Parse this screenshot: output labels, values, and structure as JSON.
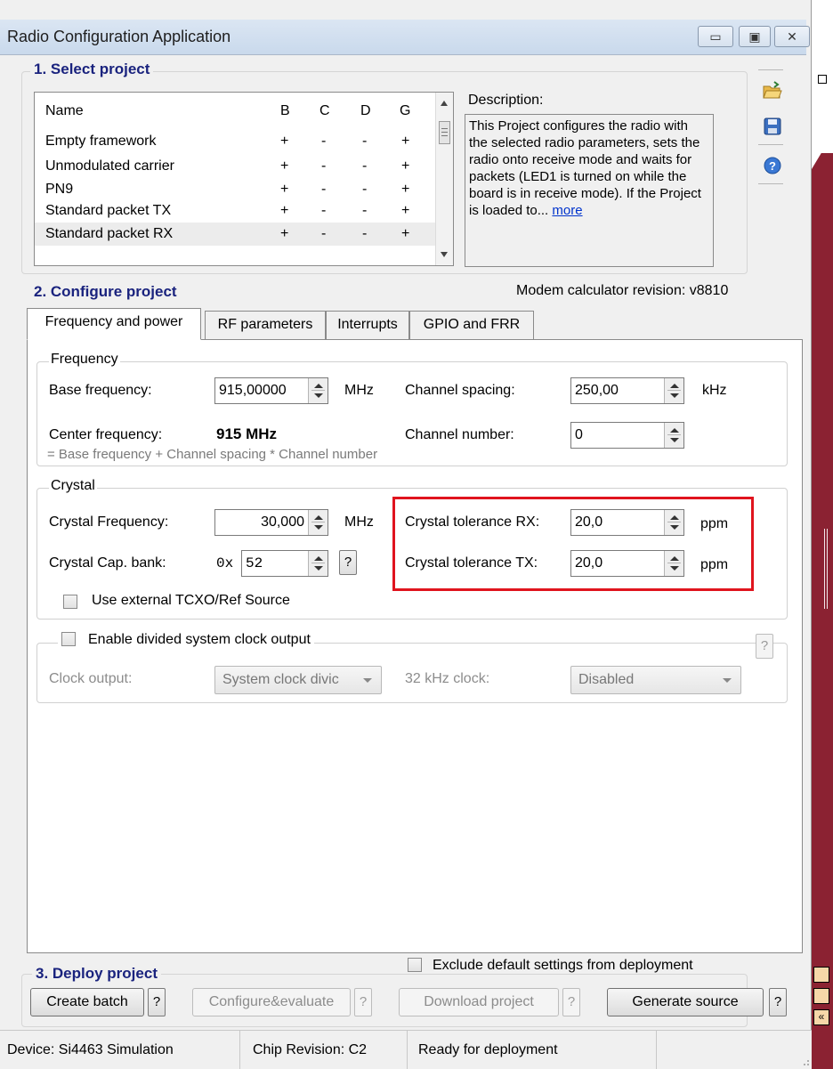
{
  "window": {
    "title": "Radio Configuration Application",
    "min_glyph": "▭",
    "restore_glyph": "▣",
    "close_glyph": "✕"
  },
  "colors": {
    "accent_title": "#1a237e",
    "highlight_red": "#e0141e",
    "side_strip": "#8b2232"
  },
  "select_project": {
    "title": "1. Select project",
    "columns": [
      "Name",
      "B",
      "C",
      "D",
      "G"
    ],
    "rows": [
      {
        "name": "Empty framework",
        "b": "+",
        "c": "-",
        "d": "-",
        "g": "+"
      },
      {
        "name": "Unmodulated carrier",
        "b": "+",
        "c": "-",
        "d": "-",
        "g": "+"
      },
      {
        "name": "PN9",
        "b": "+",
        "c": "-",
        "d": "-",
        "g": "+"
      },
      {
        "name": "Standard packet TX",
        "b": "+",
        "c": "-",
        "d": "-",
        "g": "+"
      },
      {
        "name": "Standard packet RX",
        "b": "+",
        "c": "-",
        "d": "-",
        "g": "+"
      }
    ],
    "description_label": "Description:",
    "description_text": "This Project configures the radio with the selected radio parameters, sets the radio onto receive mode and waits for packets (LED1 is turned on while the board is in receive mode). If the Project is loaded to...",
    "more_link": "more",
    "icons": [
      "open-folder-icon",
      "save-icon",
      "help-icon"
    ]
  },
  "configure_project": {
    "title": "2. Configure project",
    "modem_revision": "Modem calculator revision: v8810",
    "tabs": [
      "Frequency and power",
      "RF parameters",
      "Interrupts",
      "GPIO and FRR"
    ],
    "frequency": {
      "group": "Frequency",
      "base_label": "Base frequency:",
      "base_value": "915,00000",
      "base_unit": "MHz",
      "spacing_label": "Channel spacing:",
      "spacing_value": "250,00",
      "spacing_unit": "kHz",
      "center_label": "Center frequency:",
      "center_value": "915 MHz",
      "channel_label": "Channel number:",
      "channel_value": "0",
      "formula": "= Base frequency + Channel spacing * Channel number"
    },
    "crystal": {
      "group": "Crystal",
      "freq_label": "Crystal Frequency:",
      "freq_value": "30,000",
      "freq_unit": "MHz",
      "cap_label": "Crystal Cap. bank:",
      "cap_prefix": "0x",
      "cap_value": "52",
      "help": "?",
      "tol_rx_label": "Crystal tolerance RX:",
      "tol_rx_value": "20,0",
      "tol_rx_unit": "ppm",
      "tol_tx_label": "Crystal tolerance TX:",
      "tol_tx_value": "20,0",
      "tol_tx_unit": "ppm",
      "tcxo_label": "Use external TCXO/Ref Source"
    },
    "clock": {
      "enable_label": "Enable divided system clock output",
      "help": "?",
      "output_label": "Clock output:",
      "output_value": "System clock divic",
      "khz_label": "32 kHz clock:",
      "khz_value": "Disabled"
    }
  },
  "deploy": {
    "title": "3. Deploy project",
    "exclude_label": "Exclude default settings from deployment",
    "buttons": {
      "create_batch": "Create batch",
      "configure_evaluate": "Configure&evaluate",
      "download_project": "Download project",
      "generate_source": "Generate source",
      "help": "?"
    }
  },
  "status": {
    "device": "Device: Si4463  Simulation",
    "chip": "Chip Revision: C2",
    "state": "Ready for deployment"
  }
}
